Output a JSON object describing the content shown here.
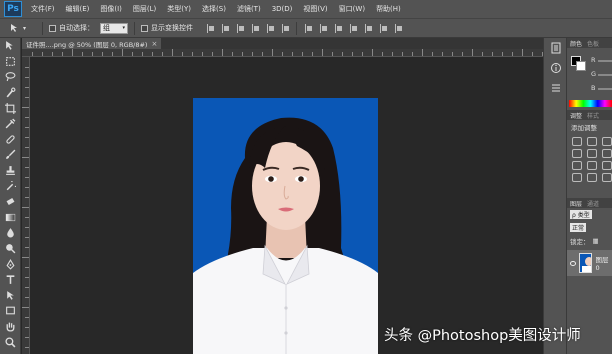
{
  "app": {
    "logo_text": "Ps"
  },
  "menu": {
    "items": [
      "文件(F)",
      "编辑(E)",
      "图像(I)",
      "图层(L)",
      "类型(Y)",
      "选择(S)",
      "滤镜(T)",
      "3D(D)",
      "视图(V)",
      "窗口(W)",
      "帮助(H)"
    ]
  },
  "options": {
    "auto_select_label": "自动选择：",
    "auto_select_value": "组",
    "show_transform_label": "显示变换控件"
  },
  "document": {
    "tab_title": "证件照....png @ 50% (图层 0, RGB/8#)",
    "close_glyph": "×"
  },
  "panels": {
    "color_tab": "颜色",
    "swatch_tab": "色板",
    "rgb_labels": [
      "R",
      "G",
      "B"
    ],
    "adjust_tab": "调整",
    "style_tab": "样式",
    "adjust_title": "添加调整",
    "layers_tab": "图层",
    "channels_tab": "通道",
    "kind_filter": "ρ 类型",
    "blend_mode": "正常",
    "lock_label": "锁定：",
    "layer_name": "图层 0"
  },
  "watermark": {
    "text": "头条 @Photoshop美图设计师"
  },
  "colors": {
    "photo_background": "#0a57b6",
    "ui_panel": "#535353",
    "canvas_bg": "#282828"
  }
}
